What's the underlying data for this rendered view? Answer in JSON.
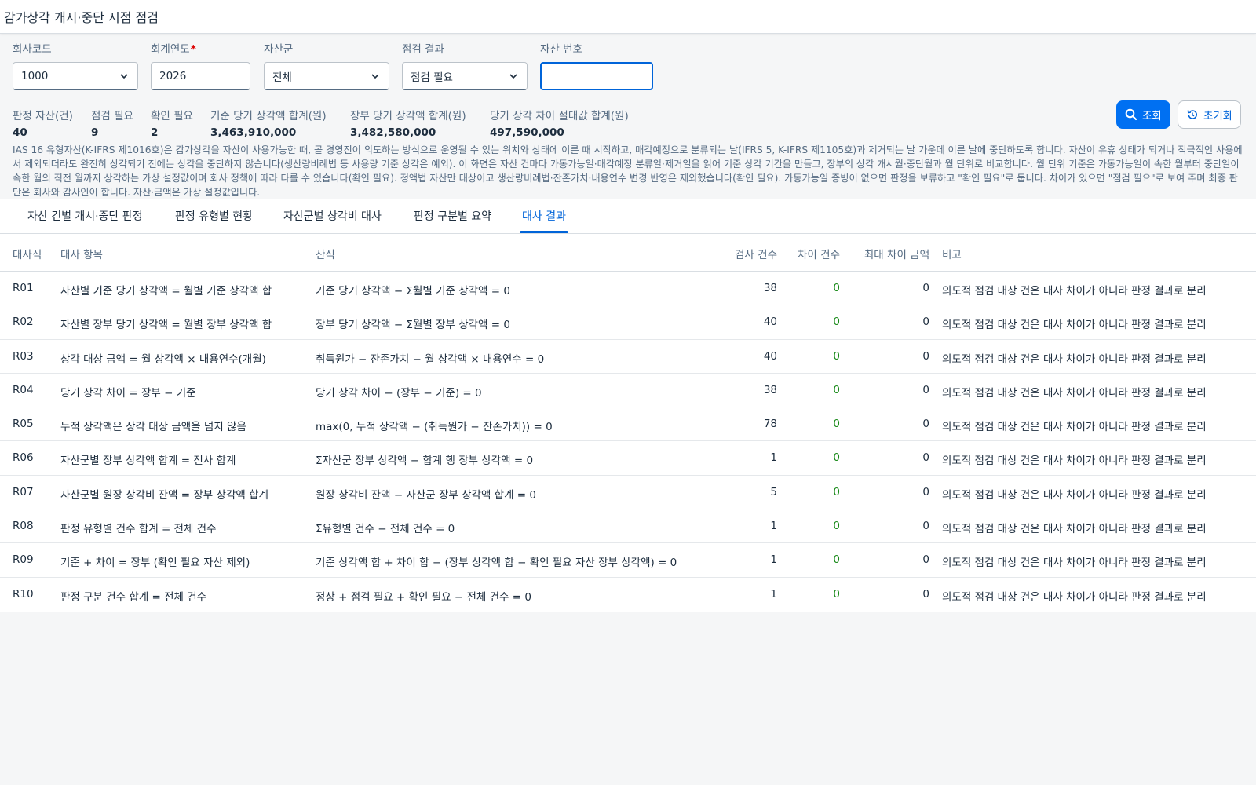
{
  "page": {
    "title": "감가상각 개시·중단 시점 점검"
  },
  "filters": {
    "company": {
      "label": "회사코드",
      "value": "1000"
    },
    "year": {
      "label": "회계연도",
      "required": "*",
      "value": "2026"
    },
    "asset_group": {
      "label": "자산군",
      "value": "전체"
    },
    "result": {
      "label": "점검 결과",
      "value": "점검 필요"
    },
    "asset_no": {
      "label": "자산 번호",
      "value": ""
    },
    "search_button": "조회",
    "reset_button": "초기화"
  },
  "summary": [
    {
      "label": "판정 자산(건)",
      "value": "40"
    },
    {
      "label": "점검 필요",
      "value": "9"
    },
    {
      "label": "확인 필요",
      "value": "2"
    },
    {
      "label": "기준 당기 상각액 합계(원)",
      "value": "3,463,910,000"
    },
    {
      "label": "장부 당기 상각액 합계(원)",
      "value": "3,482,580,000"
    },
    {
      "label": "당기 상각 차이 절대값 합계(원)",
      "value": "497,590,000"
    }
  ],
  "description": "IAS 16 유형자산(K-IFRS 제1016호)은 감가상각을 자산이 사용가능한 때, 곧 경영진이 의도하는 방식으로 운영될 수 있는 위치와 상태에 이른 때 시작하고, 매각예정으로 분류되는 날(IFRS 5, K-IFRS 제1105호)과 제거되는 날 가운데 이른 날에 중단하도록 합니다. 자산이 유휴 상태가 되거나 적극적인 사용에서 제외되더라도 완전히 상각되기 전에는 상각을 중단하지 않습니다(생산량비례법 등 사용량 기준 상각은 예외). 이 화면은 자산 건마다 가동가능일·매각예정 분류일·제거일을 읽어 기준 상각 기간을 만들고, 장부의 상각 개시월·중단월과 월 단위로 비교합니다. 월 단위 기준은 가동가능일이 속한 월부터 중단일이 속한 월의 직전 월까지 상각하는 가상 설정값이며 회사 정책에 따라 다를 수 있습니다(확인 필요). 정액법 자산만 대상이고 생산량비례법·잔존가치·내용연수 변경 반영은 제외했습니다(확인 필요). 가동가능일 증빙이 없으면 판정을 보류하고 \"확인 필요\"로 둡니다. 차이가 있으면 \"점검 필요\"로 보여 주며 최종 판단은 회사와 감사인이 합니다. 자산·금액은 가상 설정값입니다.",
  "tabs": [
    {
      "label": "자산 건별 개시·중단 판정",
      "active": false
    },
    {
      "label": "판정 유형별 현황",
      "active": false
    },
    {
      "label": "자산군별 상각비 대사",
      "active": false
    },
    {
      "label": "판정 구분별 요약",
      "active": false
    },
    {
      "label": "대사 결과",
      "active": true
    }
  ],
  "table": {
    "headers": [
      "대사식",
      "대사 항목",
      "산식",
      "검사 건수",
      "차이 건수",
      "최대 차이 금액",
      "비고"
    ],
    "rows": [
      {
        "id": "R01",
        "item": "자산별 기준 당기 상각액 = 월별 기준 상각액 합",
        "formula": "기준 당기 상각액 − Σ월별 기준 상각액 = 0",
        "count": "38",
        "diff": "0",
        "max": "0",
        "note": "의도적 점검 대상 건은 대사 차이가 아니라 판정 결과로 분리"
      },
      {
        "id": "R02",
        "item": "자산별 장부 당기 상각액 = 월별 장부 상각액 합",
        "formula": "장부 당기 상각액 − Σ월별 장부 상각액 = 0",
        "count": "40",
        "diff": "0",
        "max": "0",
        "note": "의도적 점검 대상 건은 대사 차이가 아니라 판정 결과로 분리"
      },
      {
        "id": "R03",
        "item": "상각 대상 금액 = 월 상각액 × 내용연수(개월)",
        "formula": "취득원가 − 잔존가치 − 월 상각액 × 내용연수 = 0",
        "count": "40",
        "diff": "0",
        "max": "0",
        "note": "의도적 점검 대상 건은 대사 차이가 아니라 판정 결과로 분리"
      },
      {
        "id": "R04",
        "item": "당기 상각 차이 = 장부 − 기준",
        "formula": "당기 상각 차이 − (장부 − 기준) = 0",
        "count": "38",
        "diff": "0",
        "max": "0",
        "note": "의도적 점검 대상 건은 대사 차이가 아니라 판정 결과로 분리"
      },
      {
        "id": "R05",
        "item": "누적 상각액은 상각 대상 금액을 넘지 않음",
        "formula": "max(0, 누적 상각액 − (취득원가 − 잔존가치)) = 0",
        "count": "78",
        "diff": "0",
        "max": "0",
        "note": "의도적 점검 대상 건은 대사 차이가 아니라 판정 결과로 분리"
      },
      {
        "id": "R06",
        "item": "자산군별 장부 상각액 합계 = 전사 합계",
        "formula": "Σ자산군 장부 상각액 − 합계 행 장부 상각액 = 0",
        "count": "1",
        "diff": "0",
        "max": "0",
        "note": "의도적 점검 대상 건은 대사 차이가 아니라 판정 결과로 분리"
      },
      {
        "id": "R07",
        "item": "자산군별 원장 상각비 잔액 = 장부 상각액 합계",
        "formula": "원장 상각비 잔액 − 자산군 장부 상각액 합계 = 0",
        "count": "5",
        "diff": "0",
        "max": "0",
        "note": "의도적 점검 대상 건은 대사 차이가 아니라 판정 결과로 분리"
      },
      {
        "id": "R08",
        "item": "판정 유형별 건수 합계 = 전체 건수",
        "formula": "Σ유형별 건수 − 전체 건수 = 0",
        "count": "1",
        "diff": "0",
        "max": "0",
        "note": "의도적 점검 대상 건은 대사 차이가 아니라 판정 결과로 분리"
      },
      {
        "id": "R09",
        "item": "기준 + 차이 = 장부 (확인 필요 자산 제외)",
        "formula": "기준 상각액 합 + 차이 합 − (장부 상각액 합 − 확인 필요 자산 장부 상각액) = 0",
        "count": "1",
        "diff": "0",
        "max": "0",
        "note": "의도적 점검 대상 건은 대사 차이가 아니라 판정 결과로 분리"
      },
      {
        "id": "R10",
        "item": "판정 구분 건수 합계 = 전체 건수",
        "formula": "정상 + 점검 필요 + 확인 필요 − 전체 건수 = 0",
        "count": "1",
        "diff": "0",
        "max": "0",
        "note": "의도적 점검 대상 건은 대사 차이가 아니라 판정 결과로 분리"
      }
    ]
  },
  "colors": {
    "accent": "#0070f2",
    "ok": "#188918",
    "text": "#1d2d3e",
    "muted": "#556b82"
  }
}
